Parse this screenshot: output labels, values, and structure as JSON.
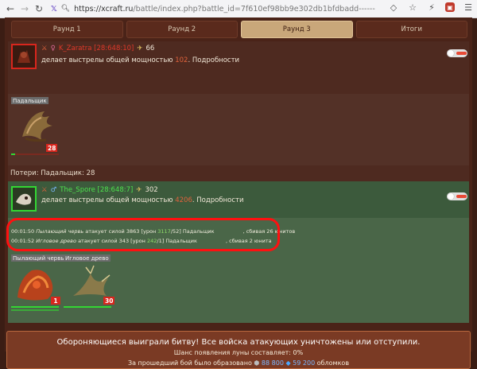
{
  "browser": {
    "url_host": "https://xcraft.ru",
    "url_path": "/battle/index.php?battle_id=7f610ef98bb9e302db1bfdbadd------"
  },
  "tabs": [
    {
      "label": "Раунд 1",
      "active": false
    },
    {
      "label": "Раунд 2",
      "active": false
    },
    {
      "label": "Раунд 3",
      "active": true
    },
    {
      "label": "Итоги",
      "active": false
    }
  ],
  "attacker": {
    "name": "K_Zaratra [28:648:10]",
    "score": "66",
    "desc_prefix": "делает выстрелы общей мощностью ",
    "power": "102",
    "desc_suffix": ". Подробности",
    "units": [
      {
        "label": "Падальщик",
        "count": "28",
        "hp_fraction": 0.08
      }
    ],
    "losses": "Потери: Падальщик: 28"
  },
  "defender": {
    "name": "The_Spore [28:648:7]",
    "score": "302",
    "desc_prefix": "делает выстрелы общей мощностью ",
    "power": "4206",
    "desc_suffix": ". Подробности",
    "units": [
      {
        "label": "Пылающий червь",
        "count": "1",
        "hp_fraction": 1.0
      },
      {
        "label": "Игловое древо",
        "count": "30",
        "hp_fraction": 1.0
      }
    ]
  },
  "log": [
    {
      "time": "00:01:50",
      "unit": "Пылающий червь",
      "mid": " атакует силой ",
      "power": "3863",
      "dmg_prefix": " [урон ",
      "dmg": "3117",
      "dmg_suffix": "/52] Падальщик ",
      "hp": "",
      "tail": ", сбивая 26 юнитов"
    },
    {
      "time": "00:01:52",
      "unit": "Игловое древо",
      "mid": " атакует силой ",
      "power": "343",
      "dmg_prefix": " [урон ",
      "dmg": "242",
      "dmg_suffix": "/1] Падальщик ",
      "hp": "",
      "tail": ", сбивая 2 юнита"
    }
  ],
  "result": {
    "title": "Обороняющиеся выиграли битву! Все войска атакующих уничтожены или отступили.",
    "moon_chance": "Шанс появления луны составляет: 0%",
    "debris_prefix": "За прошедший бой было образовано",
    "debris_metal": "88 800",
    "debris_crystal": "59 200",
    "debris_suffix": "обломков"
  },
  "colors": {
    "attacker_border": "#d8261d",
    "defender_border": "#33d633",
    "power_color": "#e0623c",
    "log_highlight": "#ff1010"
  }
}
